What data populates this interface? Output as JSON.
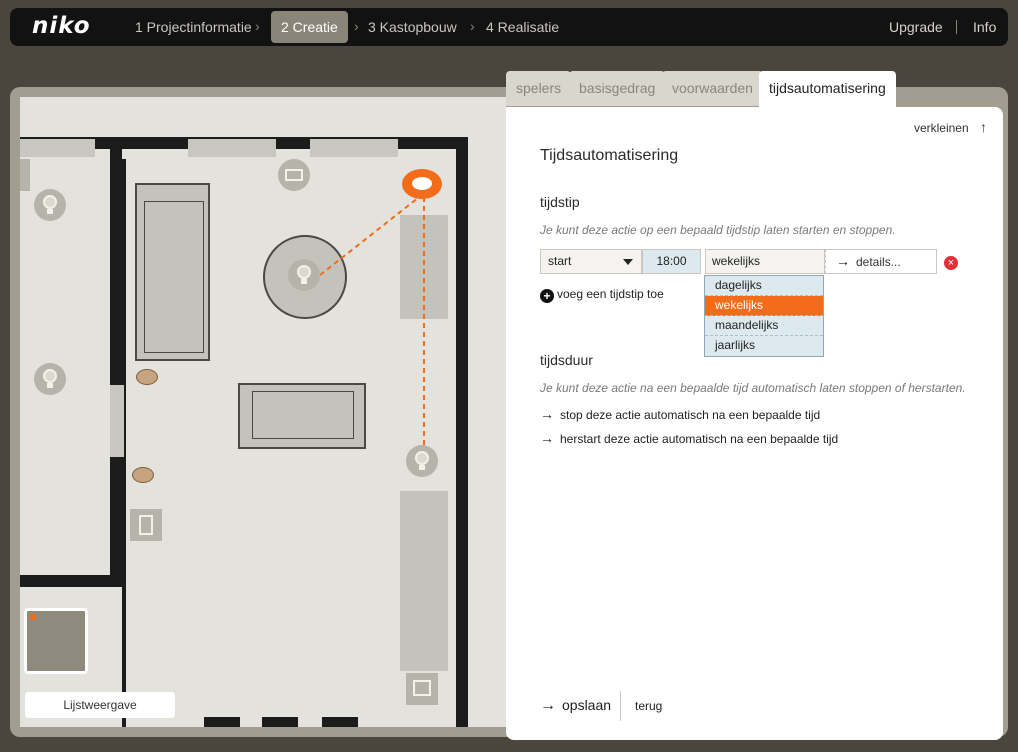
{
  "app": {
    "logo": "niko"
  },
  "steps": [
    {
      "label": "1 Projectinformatie",
      "active": false
    },
    {
      "label": "2 Creatie",
      "active": true
    },
    {
      "label": "3 Kastopbouw",
      "active": false
    },
    {
      "label": "4 Realisatie",
      "active": false
    }
  ],
  "header_links": {
    "upgrade": "Upgrade",
    "info": "Info"
  },
  "tabs": [
    {
      "label": "spelers",
      "active": false
    },
    {
      "label": "basisgedrag",
      "active": false
    },
    {
      "label": "voorwaarden",
      "active": false
    },
    {
      "label": "tijdsautomatisering",
      "active": true
    }
  ],
  "panel": {
    "collapse_label": "verkleinen",
    "title": "Tijdsautomatisering",
    "tijdstip": {
      "heading": "tijdstip",
      "description": "Je kunt deze actie op een bepaald tijdstip laten starten en stoppen.",
      "action_select": "start",
      "time": "18:00",
      "frequency": "wekelijks",
      "details": "details...",
      "frequency_options": [
        "dagelijks",
        "wekelijks",
        "maandelijks",
        "jaarlijks"
      ],
      "add_label": "voeg een tijdstip toe"
    },
    "tijdsduur": {
      "heading": "tijdsduur",
      "description": "Je kunt deze actie na een bepaalde tijd automatisch laten stoppen of herstarten.",
      "stop_link": "stop deze actie automatisch na een bepaalde tijd",
      "restart_link": "herstart deze actie automatisch na een bepaalde tijd"
    },
    "save": "opslaan",
    "back": "terug"
  },
  "plan": {
    "list_view": "Lijstweergave"
  },
  "colors": {
    "accent": "#f26c1a",
    "topbar": "#121212",
    "remove": "#e0303a",
    "time_bg": "#dceaf0"
  }
}
